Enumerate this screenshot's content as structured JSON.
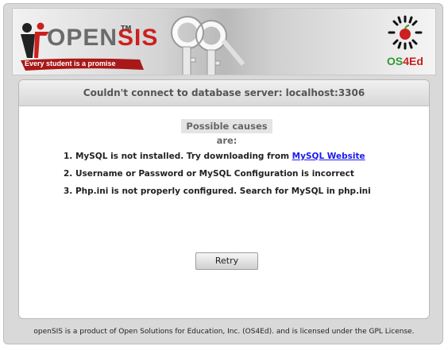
{
  "header": {
    "logo_prefix": "OPEN",
    "logo_suffix": "SIS",
    "logo_tm": "TM",
    "tagline": "Every student is a promise",
    "partner_os": "OS",
    "partner_4ed": "4Ed"
  },
  "panel": {
    "title": "Couldn't connect to database server: localhost:3306",
    "causes_heading": "Possible causes are:",
    "causes": [
      {
        "text": "1. MySQL is not installed. Try downloading from ",
        "link": "MySQL Website"
      },
      {
        "text": "2. Username or Password or MySQL Configuration is incorrect"
      },
      {
        "text": "3. Php.ini is not properly configured. Search for MySQL in php.ini"
      }
    ],
    "retry_label": "Retry"
  },
  "footer": {
    "text": "openSIS is a product of Open Solutions for Education, Inc. (OS4Ed). and is licensed under the GPL License."
  },
  "colors": {
    "logo_red": "#cc1f1f",
    "partner_green": "#2e9a2e",
    "link_blue": "#1a1aee"
  }
}
